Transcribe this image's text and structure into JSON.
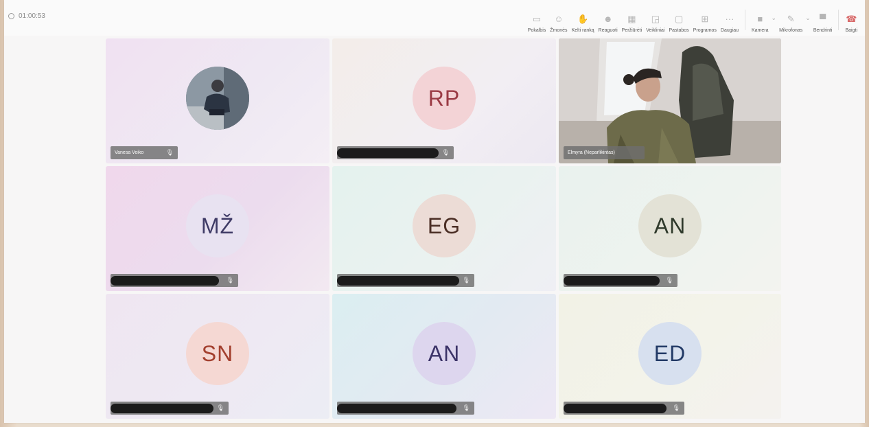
{
  "meeting": {
    "timer": "01:00:53"
  },
  "toolbar": {
    "items": [
      {
        "label": "Pokalbis",
        "icon": "chat-icon"
      },
      {
        "label": "Žmonės",
        "icon": "people-icon"
      },
      {
        "label": "Kelti ranką",
        "icon": "raise-hand-icon"
      },
      {
        "label": "Reaguoti",
        "icon": "react-icon"
      },
      {
        "label": "Peržiūrėti",
        "icon": "view-icon"
      },
      {
        "label": "Veikliniai",
        "icon": "rooms-icon"
      },
      {
        "label": "Pastabos",
        "icon": "notes-icon"
      },
      {
        "label": "Programos",
        "icon": "apps-icon"
      },
      {
        "label": "Daugiau",
        "icon": "more-icon"
      }
    ],
    "camera_label": "Kamera",
    "mic_label": "Mikrofonas",
    "share_label": "Bendrinti",
    "leave_label": "Baigti"
  },
  "tiles": [
    {
      "name": "Vanesa Voiko",
      "type": "photo"
    },
    {
      "initials": "RP",
      "avatar_bg": "#f3d3d6",
      "initials_color": "#9a3a44",
      "type": "initials"
    },
    {
      "name": "Elmyra (Neparlikintas)",
      "type": "video"
    },
    {
      "initials": "MŽ",
      "avatar_bg": "#e8e2f1",
      "initials_color": "#3f3b66",
      "type": "initials"
    },
    {
      "initials": "EG",
      "avatar_bg": "#ecdcd6",
      "initials_color": "#4b2e25",
      "type": "initials"
    },
    {
      "initials": "AN",
      "avatar_bg": "#e3e2d6",
      "initials_color": "#2f3a2b",
      "type": "initials"
    },
    {
      "initials": "SN",
      "avatar_bg": "#f5d8d3",
      "initials_color": "#a3402f",
      "type": "initials"
    },
    {
      "initials": "AN",
      "avatar_bg": "#ddd6ee",
      "initials_color": "#3c3468",
      "type": "initials"
    },
    {
      "initials": "ED",
      "avatar_bg": "#d7e0ef",
      "initials_color": "#223a66",
      "type": "initials"
    }
  ],
  "colors": {
    "active_speaker": "#6b65c9",
    "leave": "#d86a6a"
  }
}
